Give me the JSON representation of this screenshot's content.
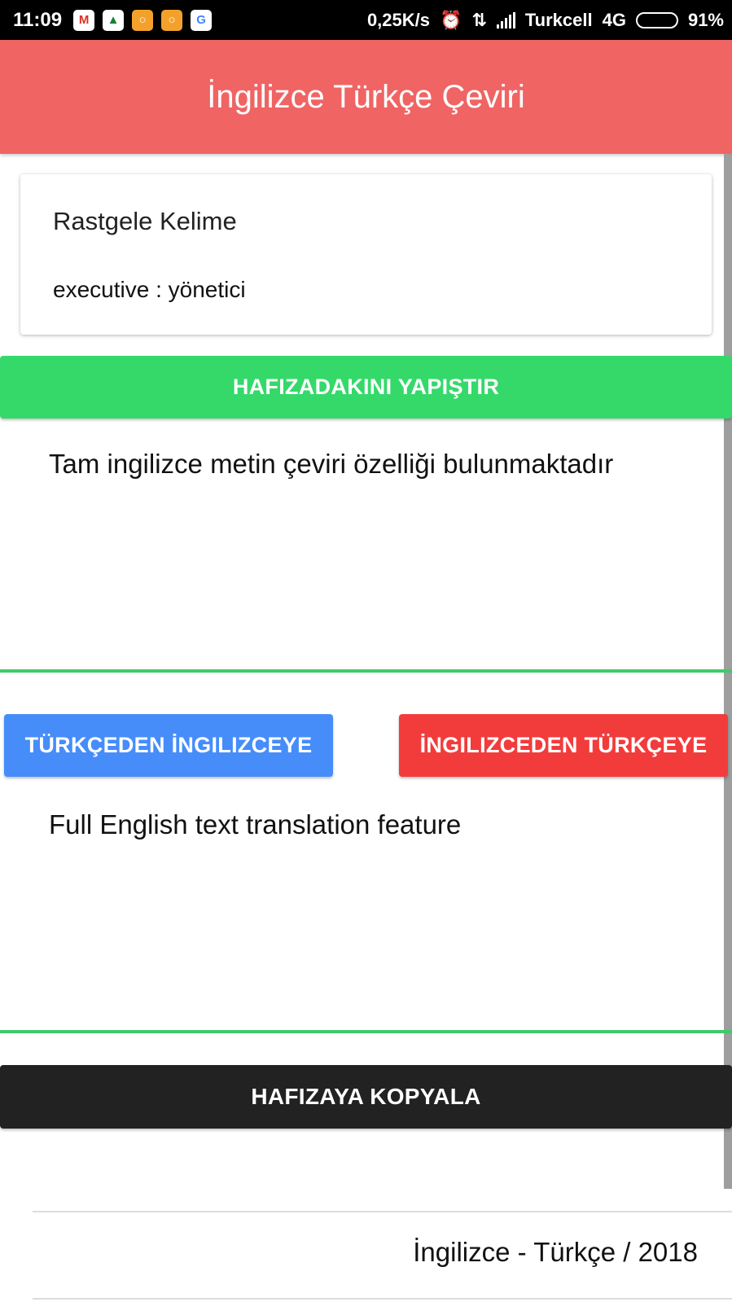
{
  "status_bar": {
    "time": "11:09",
    "notification_icons": [
      "gmail-icon",
      "drive-icon",
      "orange-app-icon",
      "orange-app-icon",
      "google-icon"
    ],
    "speed": "0,25K/s",
    "carrier": "Turkcell",
    "network": "4G",
    "battery": "91%",
    "battery_level": 0.91
  },
  "app_bar": {
    "title": "İngilizce Türkçe Çeviri"
  },
  "random_word_card": {
    "title": "Rastgele Kelime",
    "word": "executive : yönetici"
  },
  "buttons": {
    "paste": "HAFIZADAKINI YAPIŞTIR",
    "tr_to_en": "TÜRKÇEDEN İNGILIZCEYE",
    "en_to_tr": "İNGILIZCEDEN TÜRKÇEYE",
    "copy": "HAFIZAYA KOPYALA"
  },
  "input_text": "Tam ingilizce metin çeviri özelliği bulunmaktadır",
  "output_text": "Full English text translation feature",
  "footer": "İngilizce - Türkçe / 2018",
  "colors": {
    "app_bar": "#f06464",
    "paste_button": "#34d96a",
    "tr_en_button": "#468dfa",
    "en_tr_button": "#f23c3c",
    "copy_button": "#222222",
    "underline": "#3dcb6a"
  }
}
